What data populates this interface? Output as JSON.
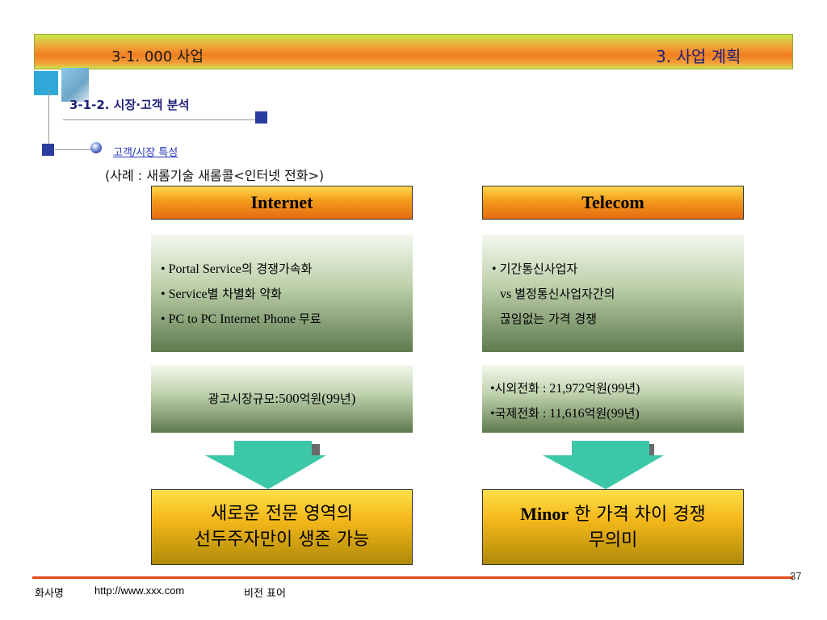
{
  "header": {
    "section": "3-1. 000 사업",
    "chapter": "3. 사업 계획"
  },
  "subtitle": "3-1-2. 시장·고객 분석",
  "bullet_link": "고객/시장 특성",
  "example": "(사례 : 새롬기술 새롬콜<인터넷 전화>)",
  "columns": {
    "left": {
      "title": "Internet",
      "features": [
        {
          "bullet": "• ",
          "en": "Portal Service",
          "ko": "의 경쟁가속화"
        },
        {
          "bullet": "• ",
          "en": "Service",
          "ko": "별 차별화 약화"
        },
        {
          "bullet": "• ",
          "en": "PC to PC Internet Phone ",
          "ko": "무료"
        }
      ],
      "market": {
        "ko1": "광고시장규모",
        "en": ":500",
        "ko2": "억원",
        "en2": "(99",
        "ko3": "년",
        "en3": ")"
      },
      "result": [
        "새로운 전문 영역의",
        "선두주자만이 생존 가능"
      ]
    },
    "right": {
      "title": "Telecom",
      "features": [
        {
          "bullet": "• ",
          "ko": "기간통신사업자"
        },
        {
          "en": "vs ",
          "ko": "별정통신사업자간의"
        },
        {
          "ko": "끊임없는 가격 경쟁"
        }
      ],
      "market": [
        {
          "bullet": "•",
          "ko1": "시외전화",
          "en": " : 21,972",
          "ko2": "억원",
          "en2": "(99",
          "ko3": "년",
          "en3": ")"
        },
        {
          "bullet": "•",
          "ko1": "국제전화",
          "en": " : 11,616",
          "ko2": "억원",
          "en2": "(99",
          "ko3": "년",
          "en3": ")"
        }
      ],
      "result": {
        "en": "Minor",
        "ko1": " 한 가격 차이 경쟁",
        "ko2": "무의미"
      }
    }
  },
  "footer": {
    "company": "화사명",
    "url": "http://www.xxx.com",
    "vision": "비전 표어",
    "page": "37"
  },
  "colors": {
    "accent_orange": "#f07e1e",
    "navy": "#1e1e7a",
    "square_blue": "#2b3b9f",
    "arrow_teal": "#3cc8a8",
    "footer_red": "#e04a1a"
  }
}
